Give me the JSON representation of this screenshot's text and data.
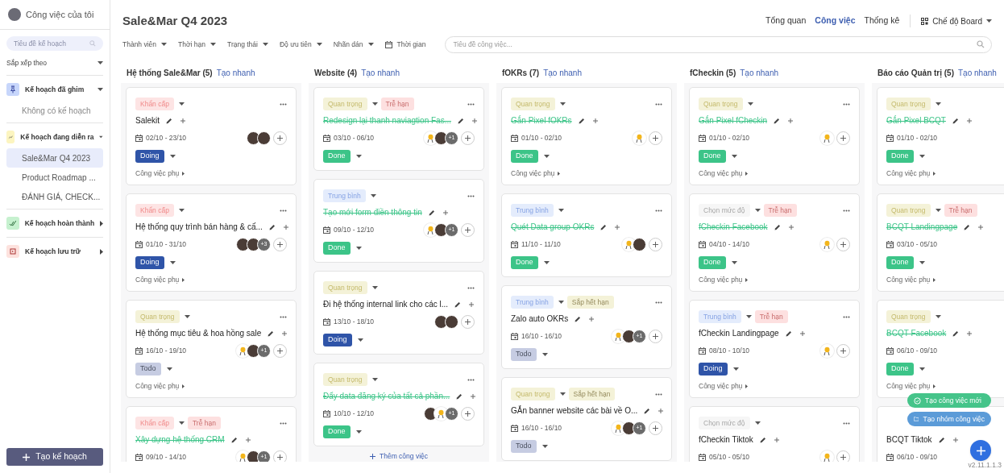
{
  "sidebar": {
    "title": "Công việc của tôi",
    "search": {
      "placeholder": "Tiêu đề kế hoạch"
    },
    "sort_label": "Sắp xếp theo",
    "groups": [
      {
        "kind": "pinned",
        "label": "Kế hoạch đã ghim",
        "expanded": true,
        "empty_text": "Không có kế hoạch"
      },
      {
        "kind": "ongoing",
        "label": "Kế hoạch đang diễn ra",
        "expanded": true,
        "items": [
          {
            "label": "Sale&Mar Q4 2023",
            "selected": true
          },
          {
            "label": "Product Roadmap ...",
            "selected": false
          },
          {
            "label": "ĐÁNH GIÁ, CHECK...",
            "selected": false
          }
        ]
      },
      {
        "kind": "completed",
        "label": "Kế hoạch hoàn thành",
        "expanded": false
      },
      {
        "kind": "archived",
        "label": "Kế hoạch lưu trữ",
        "expanded": false
      }
    ],
    "create_button": "Tạo kế hoạch"
  },
  "header": {
    "title": "Sale&Mar Q4 2023",
    "nav": [
      {
        "label": "Tổng quan",
        "selected": false
      },
      {
        "label": "Công việc",
        "selected": true
      },
      {
        "label": "Thống kê",
        "selected": false
      }
    ],
    "view_mode": "Chế độ Board"
  },
  "filters": [
    {
      "label": "Thành viên",
      "kind": "dropdown"
    },
    {
      "label": "Thời hạn",
      "kind": "dropdown"
    },
    {
      "label": "Trạng thái",
      "kind": "dropdown"
    },
    {
      "label": "Độ ưu tiên",
      "kind": "dropdown"
    },
    {
      "label": "Nhãn dán",
      "kind": "dropdown"
    },
    {
      "label": "Thời gian",
      "kind": "date"
    }
  ],
  "task_search": {
    "placeholder": "Tiêu đề công việc..."
  },
  "columns": [
    {
      "title": "Hệ thống Sale&Mar (5)",
      "quick_add": "Tạo nhanh",
      "cards": [
        {
          "priority": {
            "label": "Khẩn cấp",
            "kind": "urgent"
          },
          "title": "Salekit",
          "done": false,
          "date": "02/10 - 23/10",
          "assignees": [
            {
              "kind": "photo"
            },
            {
              "kind": "photo"
            }
          ],
          "status": {
            "label": "Doing",
            "kind": "doing"
          },
          "subtasks": "Công việc phụ"
        },
        {
          "priority": {
            "label": "Khẩn cấp",
            "kind": "urgent"
          },
          "title": "Hệ thống quy trình bán hàng & cấ...",
          "done": false,
          "date": "01/10 - 31/10",
          "assignees": [
            {
              "kind": "photo"
            },
            {
              "kind": "photo"
            },
            {
              "kind": "more",
              "label": "+3"
            }
          ],
          "status": {
            "label": "Doing",
            "kind": "doing"
          },
          "subtasks": "Công việc phụ"
        },
        {
          "priority": {
            "label": "Quan trọng",
            "kind": "important"
          },
          "title": "Hệ thống mục tiêu & hoa hồng sale",
          "done": false,
          "date": "16/10 - 19/10",
          "assignees": [
            {
              "kind": "chick"
            },
            {
              "kind": "photo"
            },
            {
              "kind": "more",
              "label": "+1"
            }
          ],
          "status": {
            "label": "Todo",
            "kind": "todo"
          },
          "subtasks": "Công việc phụ"
        },
        {
          "priority": {
            "label": "Khẩn cấp",
            "kind": "urgent"
          },
          "deadline": {
            "label": "Trễ hạn",
            "kind": "overdue"
          },
          "title": "Xây dựng hệ thống CRM",
          "done": true,
          "date": "09/10 - 14/10",
          "assignees": [
            {
              "kind": "chick"
            },
            {
              "kind": "photo"
            },
            {
              "kind": "more",
              "label": "+1"
            }
          ]
        }
      ]
    },
    {
      "title": "Website (4)",
      "quick_add": "Tạo nhanh",
      "add_task": "Thêm công việc",
      "cards": [
        {
          "priority": {
            "label": "Quan trọng",
            "kind": "important"
          },
          "deadline": {
            "label": "Trễ hạn",
            "kind": "overdue"
          },
          "title": "Redesign lại thanh naviagtion Fas...",
          "done": true,
          "date": "03/10 - 06/10",
          "assignees": [
            {
              "kind": "chick"
            },
            {
              "kind": "photo"
            },
            {
              "kind": "more",
              "label": "+1"
            }
          ],
          "status": {
            "label": "Done",
            "kind": "done"
          }
        },
        {
          "priority": {
            "label": "Trung bình",
            "kind": "medium"
          },
          "title": "Tạo mới form điền thông tin",
          "done": true,
          "date": "09/10 - 12/10",
          "assignees": [
            {
              "kind": "chick"
            },
            {
              "kind": "photo"
            },
            {
              "kind": "more",
              "label": "+1"
            }
          ],
          "status": {
            "label": "Done",
            "kind": "done"
          }
        },
        {
          "priority": {
            "label": "Quan trọng",
            "kind": "important"
          },
          "title": "Đi hệ thống internal link cho các l...",
          "done": false,
          "date": "13/10 - 18/10",
          "assignees": [
            {
              "kind": "photo"
            },
            {
              "kind": "photo"
            }
          ],
          "status": {
            "label": "Doing",
            "kind": "doing"
          }
        },
        {
          "priority": {
            "label": "Quan trọng",
            "kind": "important"
          },
          "title": "Đẩy data đăng ký của tất cả phần...",
          "done": true,
          "date": "10/10 - 12/10",
          "assignees": [
            {
              "kind": "photo"
            },
            {
              "kind": "chick"
            },
            {
              "kind": "more",
              "label": "+1"
            }
          ],
          "status": {
            "label": "Done",
            "kind": "done"
          }
        }
      ]
    },
    {
      "title": "fOKRs (7)",
      "quick_add": "Tạo nhanh",
      "cards": [
        {
          "priority": {
            "label": "Quan trọng",
            "kind": "important"
          },
          "title": "Gắn Pixel fOKRs",
          "done": true,
          "date": "01/10 - 02/10",
          "assignees": [
            {
              "kind": "chick"
            }
          ],
          "status": {
            "label": "Done",
            "kind": "done"
          },
          "subtasks": "Công việc phụ"
        },
        {
          "priority": {
            "label": "Trung bình",
            "kind": "medium"
          },
          "title": "Quét Data group OKRs",
          "done": true,
          "date": "11/10 - 11/10",
          "assignees": [
            {
              "kind": "chick"
            },
            {
              "kind": "photo"
            }
          ],
          "status": {
            "label": "Done",
            "kind": "done"
          }
        },
        {
          "priority": {
            "label": "Trung bình",
            "kind": "medium"
          },
          "deadline": {
            "label": "Sắp hết hạn",
            "kind": "near"
          },
          "title": "Zalo auto OKRs",
          "done": false,
          "date": "16/10 - 16/10",
          "assignees": [
            {
              "kind": "chick"
            },
            {
              "kind": "photo"
            },
            {
              "kind": "more",
              "label": "+1"
            }
          ],
          "status": {
            "label": "Todo",
            "kind": "todo"
          }
        },
        {
          "priority": {
            "label": "Quan trọng",
            "kind": "important"
          },
          "deadline": {
            "label": "Sắp hết hạn",
            "kind": "near"
          },
          "title": "GẮn banner website các bài về O...",
          "done": false,
          "date": "16/10 - 16/10",
          "assignees": [
            {
              "kind": "chick"
            },
            {
              "kind": "photo"
            },
            {
              "kind": "more",
              "label": "+1"
            }
          ],
          "status": {
            "label": "Todo",
            "kind": "todo"
          }
        }
      ]
    },
    {
      "title": "fCheckin (5)",
      "quick_add": "Tạo nhanh",
      "cards": [
        {
          "priority": {
            "label": "Quan trọng",
            "kind": "important"
          },
          "title": "Gắn Pixel fCheckin",
          "done": true,
          "date": "01/10 - 02/10",
          "assignees": [
            {
              "kind": "chick"
            }
          ],
          "status": {
            "label": "Done",
            "kind": "done"
          },
          "subtasks": "Công việc phụ"
        },
        {
          "priority": {
            "label": "Chọn mức độ",
            "kind": "none"
          },
          "deadline": {
            "label": "Trễ hạn",
            "kind": "overdue"
          },
          "title": "fCheckin Facebook",
          "done": true,
          "date": "04/10 - 14/10",
          "assignees": [
            {
              "kind": "chick"
            }
          ],
          "status": {
            "label": "Done",
            "kind": "done"
          },
          "subtasks": "Công việc phụ"
        },
        {
          "priority": {
            "label": "Trung bình",
            "kind": "medium"
          },
          "deadline": {
            "label": "Trễ hạn",
            "kind": "overdue"
          },
          "title": "fCheckin Landingpage",
          "done": false,
          "date": "08/10 - 10/10",
          "assignees": [
            {
              "kind": "chick"
            }
          ],
          "status": {
            "label": "Doing",
            "kind": "doing"
          },
          "subtasks": "Công việc phụ"
        },
        {
          "priority": {
            "label": "Chọn mức độ",
            "kind": "none"
          },
          "title": "fCheckin Tiktok",
          "done": false,
          "date": "05/10 - 05/10",
          "assignees": [
            {
              "kind": "chick"
            }
          ]
        }
      ]
    },
    {
      "title": "Báo cáo Quản trị (5)",
      "quick_add": "Tạo nhanh",
      "cards": [
        {
          "priority": {
            "label": "Quan trọng",
            "kind": "important"
          },
          "title": "Gắn Pixel BCQT",
          "done": true,
          "date": "01/10 - 02/10",
          "status": {
            "label": "Done",
            "kind": "done"
          },
          "subtasks": "Công việc phụ"
        },
        {
          "priority": {
            "label": "Quan trọng",
            "kind": "important"
          },
          "deadline": {
            "label": "Trễ hạn",
            "kind": "overdue"
          },
          "title": "BCQT Landingpage",
          "done": true,
          "date": "03/10 - 05/10",
          "status": {
            "label": "Done",
            "kind": "done"
          },
          "subtasks": "Công việc phụ"
        },
        {
          "priority": {
            "label": "Quan trọng",
            "kind": "important"
          },
          "title": "BCQT Facebook",
          "done": true,
          "date": "06/10 - 09/10",
          "status": {
            "label": "Done",
            "kind": "done"
          },
          "subtasks": "Công việc phụ"
        },
        {
          "title": "BCQT Tiktok",
          "done": false,
          "date": "06/10 - 09/10"
        }
      ]
    }
  ],
  "fab_actions": [
    {
      "label": "Tạo công việc mới",
      "kind": "task"
    },
    {
      "label": "Tạo nhóm công việc",
      "kind": "group"
    }
  ],
  "version": "v2.11.1.1.3"
}
